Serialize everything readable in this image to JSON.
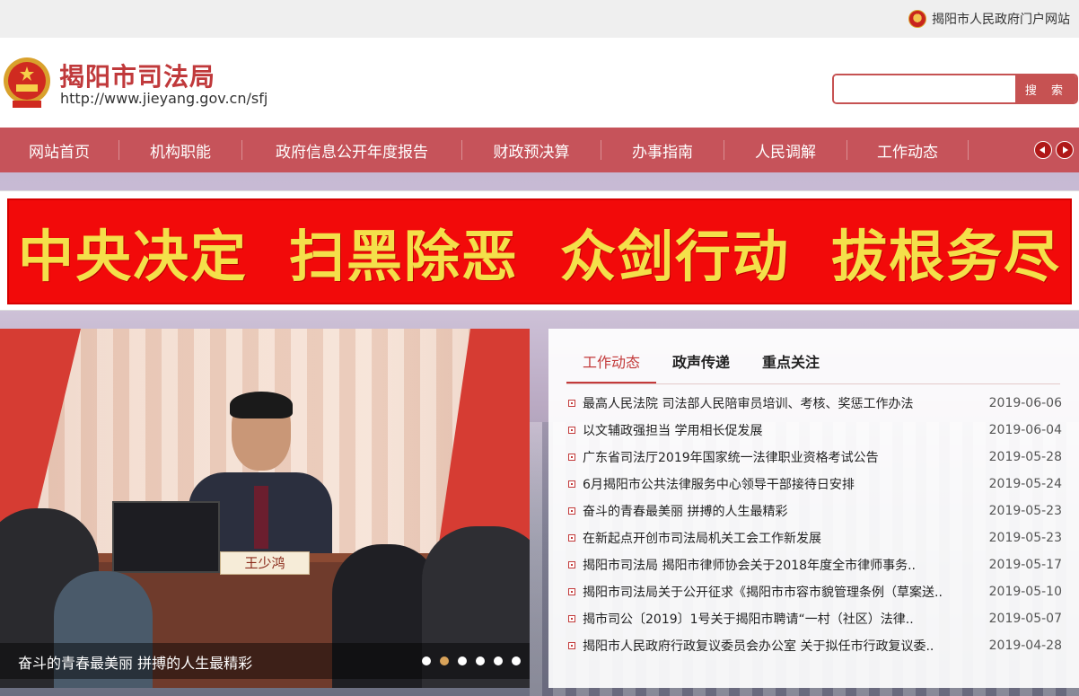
{
  "topbar": {
    "portal_link": "揭阳市人民政府门户网站",
    "portal_icon": "national-emblem-icon"
  },
  "header": {
    "title": "揭阳市司法局",
    "url": "http://www.jieyang.gov.cn/sfj",
    "emblem_icon": "national-emblem-icon"
  },
  "search": {
    "placeholder": "",
    "value": "",
    "button_label": "搜 索"
  },
  "nav": {
    "items": [
      {
        "label": "网站首页",
        "width": 132
      },
      {
        "label": "机构职能",
        "width": 136
      },
      {
        "label": "政府信息公开年度报告",
        "width": 244
      },
      {
        "label": "财政预决算",
        "width": 154
      },
      {
        "label": "办事指南",
        "width": 136
      },
      {
        "label": "人民调解",
        "width": 136
      },
      {
        "label": "工作动态",
        "width": 134
      }
    ],
    "prev_icon": "arrow-left-icon",
    "next_icon": "arrow-right-icon"
  },
  "banner": {
    "phrases": [
      "中央决定",
      "扫黑除恶",
      "众剑行动",
      "拔根务尽"
    ],
    "background_color": "#f20a0a",
    "text_color": "#f4e04a"
  },
  "slider": {
    "nameplate": "王少鸿",
    "caption": "奋斗的青春最美丽 拼搏的人生最精彩",
    "dots": 6,
    "active_dot": 1
  },
  "news": {
    "tabs": [
      {
        "label": "工作动态",
        "active": true
      },
      {
        "label": "政声传递",
        "active": false
      },
      {
        "label": "重点关注",
        "active": false
      }
    ],
    "items": [
      {
        "title": "最高人民法院 司法部人民陪审员培训、考核、奖惩工作办法",
        "date": "2019-06-06"
      },
      {
        "title": "以文辅政强担当 学用相长促发展",
        "date": "2019-06-04"
      },
      {
        "title": "广东省司法厅2019年国家统一法律职业资格考试公告",
        "date": "2019-05-28"
      },
      {
        "title": "6月揭阳市公共法律服务中心领导干部接待日安排",
        "date": "2019-05-24"
      },
      {
        "title": "奋斗的青春最美丽 拼搏的人生最精彩",
        "date": "2019-05-23"
      },
      {
        "title": "在新起点开创市司法局机关工会工作新发展",
        "date": "2019-05-23"
      },
      {
        "title": "揭阳市司法局 揭阳市律师协会关于2018年度全市律师事务..",
        "date": "2019-05-17"
      },
      {
        "title": "揭阳市司法局关于公开征求《揭阳市市容市貌管理条例（草案送..",
        "date": "2019-05-10"
      },
      {
        "title": "揭市司公〔2019〕1号关于揭阳市聘请“一村（社区）法律..",
        "date": "2019-05-07"
      },
      {
        "title": "揭阳市人民政府行政复议委员会办公室 关于拟任市行政复议委..",
        "date": "2019-04-28"
      }
    ]
  },
  "colors": {
    "brand_red": "#c6535a",
    "title_red": "#c0393b",
    "tab_active": "#c33b3b"
  }
}
